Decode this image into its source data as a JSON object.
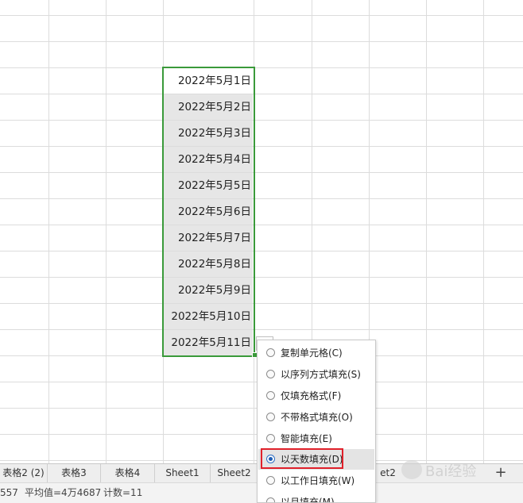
{
  "cells": [
    "2022年5月1日",
    "2022年5月2日",
    "2022年5月3日",
    "2022年5月4日",
    "2022年5月5日",
    "2022年5月6日",
    "2022年5月7日",
    "2022年5月8日",
    "2022年5月9日",
    "2022年5月10日",
    "2022年5月11日"
  ],
  "sheet_tabs": [
    "表格2 (2)",
    "表格3",
    "表格4",
    "Sheet1",
    "Sheet2",
    "et2"
  ],
  "add_sheet_label": "+",
  "status": {
    "sum_fragment": "557",
    "average": "平均值=4万4687",
    "count": "计数=11"
  },
  "autofill_menu": {
    "items": [
      {
        "label": "复制单元格(C)",
        "selected": false
      },
      {
        "label": "以序列方式填充(S)",
        "selected": false
      },
      {
        "label": "仅填充格式(F)",
        "selected": false
      },
      {
        "label": "不带格式填充(O)",
        "selected": false
      },
      {
        "label": "智能填充(E)",
        "selected": false
      },
      {
        "label": "以天数填充(D)",
        "selected": true
      },
      {
        "label": "以工作日填充(W)",
        "selected": false
      },
      {
        "label": "以月填充(M)",
        "selected": false
      }
    ],
    "highlighted_index": 5
  },
  "watermark": {
    "text": "Bai经验"
  },
  "colors": {
    "selection_border": "#3a9a3a",
    "highlight_box": "#e0202a",
    "radio_selected": "#1f5fb5"
  }
}
